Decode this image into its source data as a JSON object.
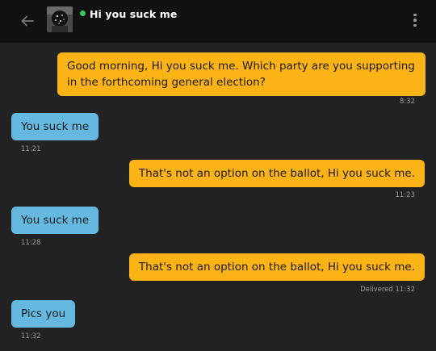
{
  "header": {
    "back_icon": "arrow-left-icon",
    "contact_name": "Hi you suck me",
    "status_color": "#36c95f",
    "menu_icon": "more-vertical-icon"
  },
  "colors": {
    "background": "#222222",
    "topbar": "#111111",
    "outgoing_bubble": "#fcb315",
    "incoming_bubble": "#65b9e0",
    "timestamp": "#9b9b9b"
  },
  "messages": [
    {
      "direction": "outgoing",
      "text": "Good morning, Hi you suck me. Which party are you supporting in the forthcoming general election?",
      "time": "8:32"
    },
    {
      "direction": "incoming",
      "text": "You suck me",
      "time": "11:21"
    },
    {
      "direction": "outgoing",
      "text": "That's not an option on the ballot, Hi you suck me.",
      "time": "11:23"
    },
    {
      "direction": "incoming",
      "text": "You suck me",
      "time": "11:28"
    },
    {
      "direction": "outgoing",
      "text": "That's not an option on the ballot, Hi you suck me.",
      "time": "Delivered 11:32"
    },
    {
      "direction": "incoming",
      "text": "Pics you",
      "time": "11:32"
    }
  ]
}
